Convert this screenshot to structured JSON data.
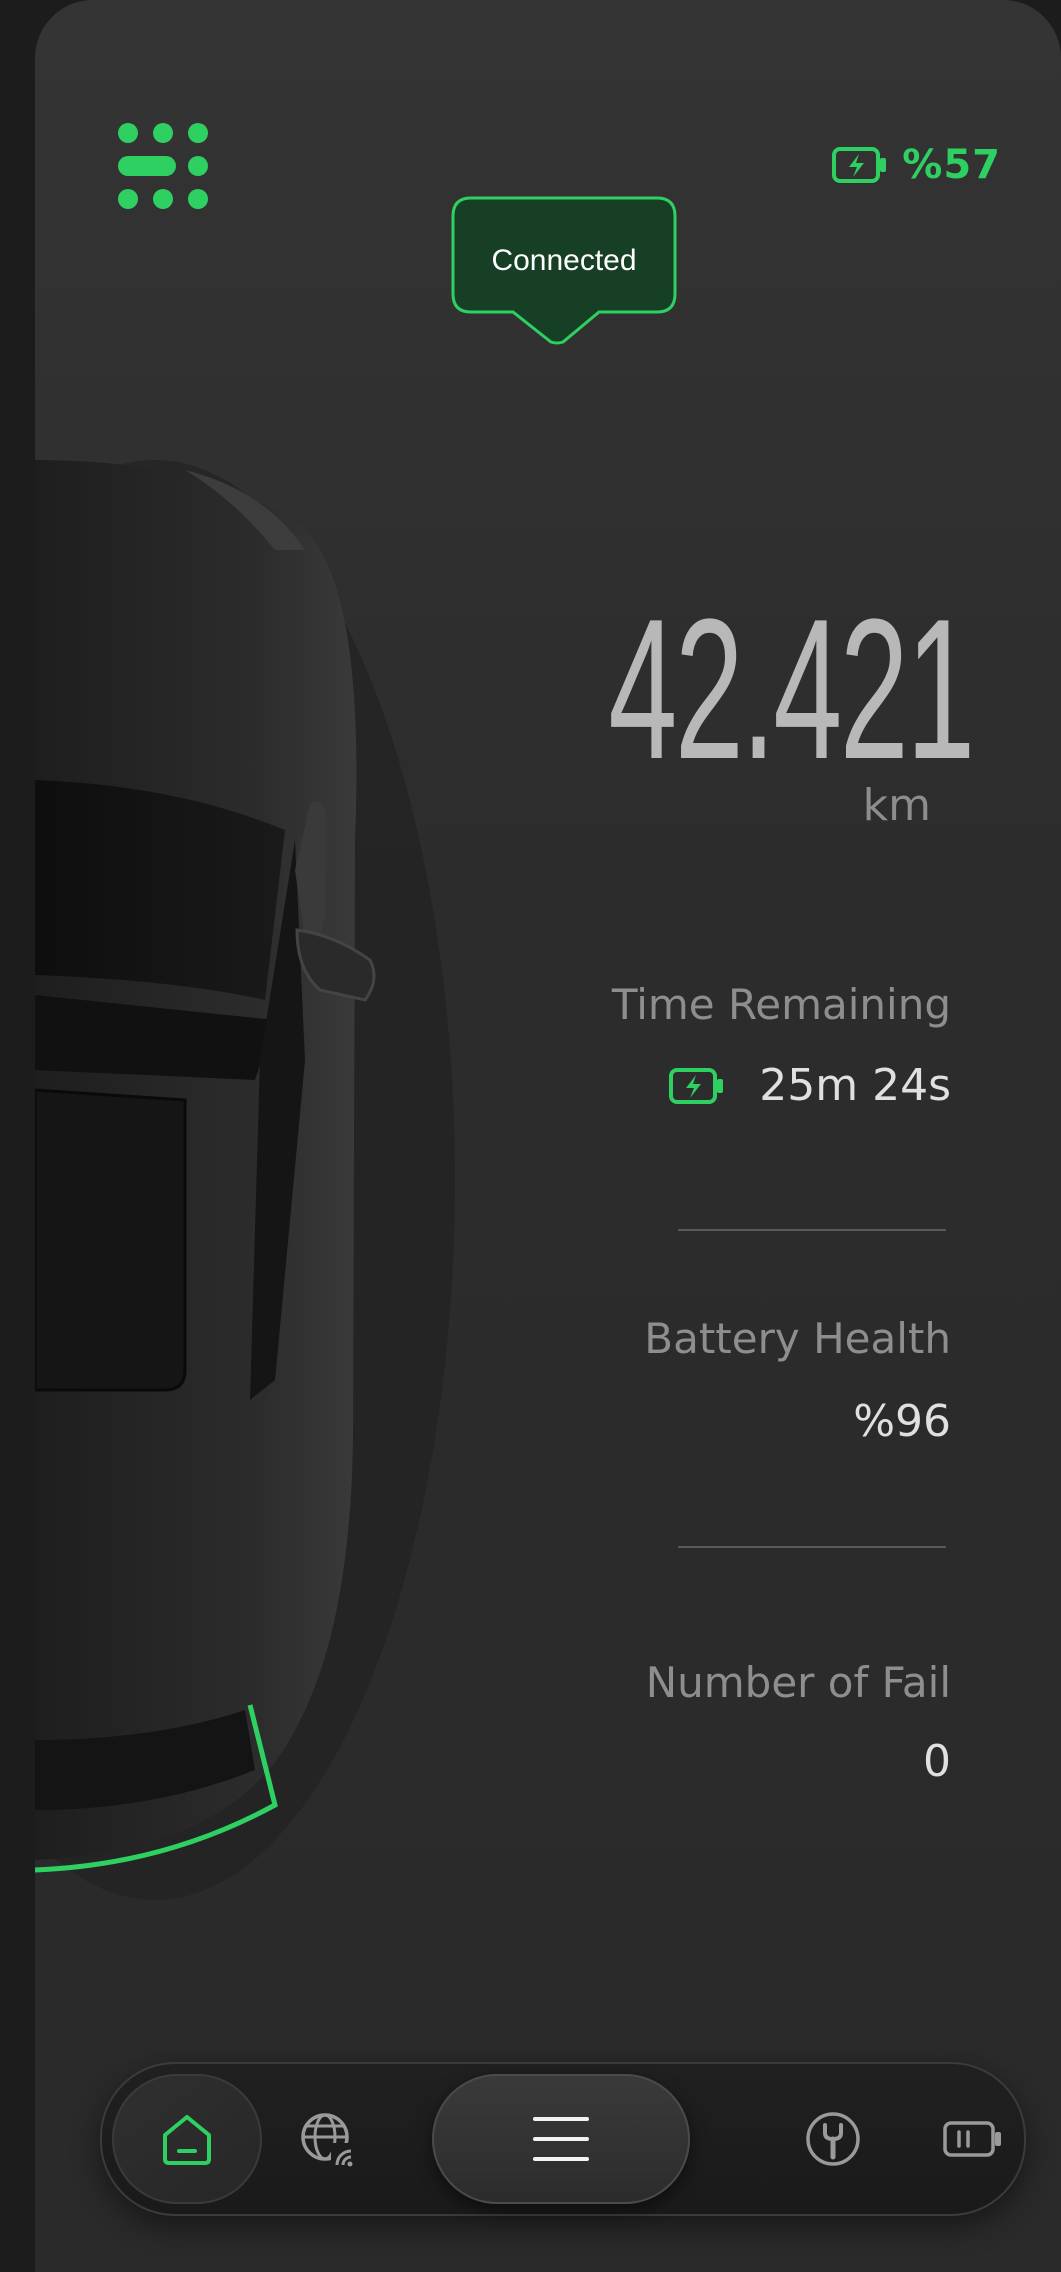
{
  "status": {
    "connection_label": "Connected",
    "battery_percent_text": "%57",
    "accent_color": "#2ed062"
  },
  "odometer": {
    "value": "42.421",
    "unit": "km"
  },
  "stats": {
    "time_remaining_label": "Time Remaining",
    "time_remaining_value": "25m 24s",
    "battery_health_label": "Battery Health",
    "battery_health_value": "%96",
    "fail_label": "Number of Fail",
    "fail_value": "0"
  },
  "nav": {
    "items": [
      {
        "name": "home",
        "icon": "home-icon",
        "active": true
      },
      {
        "name": "globe",
        "icon": "globe-wifi-icon",
        "active": false
      },
      {
        "name": "menu",
        "icon": "hamburger-icon",
        "active": false
      },
      {
        "name": "service",
        "icon": "wrench-icon",
        "active": false
      },
      {
        "name": "battery",
        "icon": "battery-icon",
        "active": false
      }
    ]
  },
  "icons": {
    "top_left": "dots-grid-menu-icon",
    "top_right": "battery-charging-icon"
  }
}
